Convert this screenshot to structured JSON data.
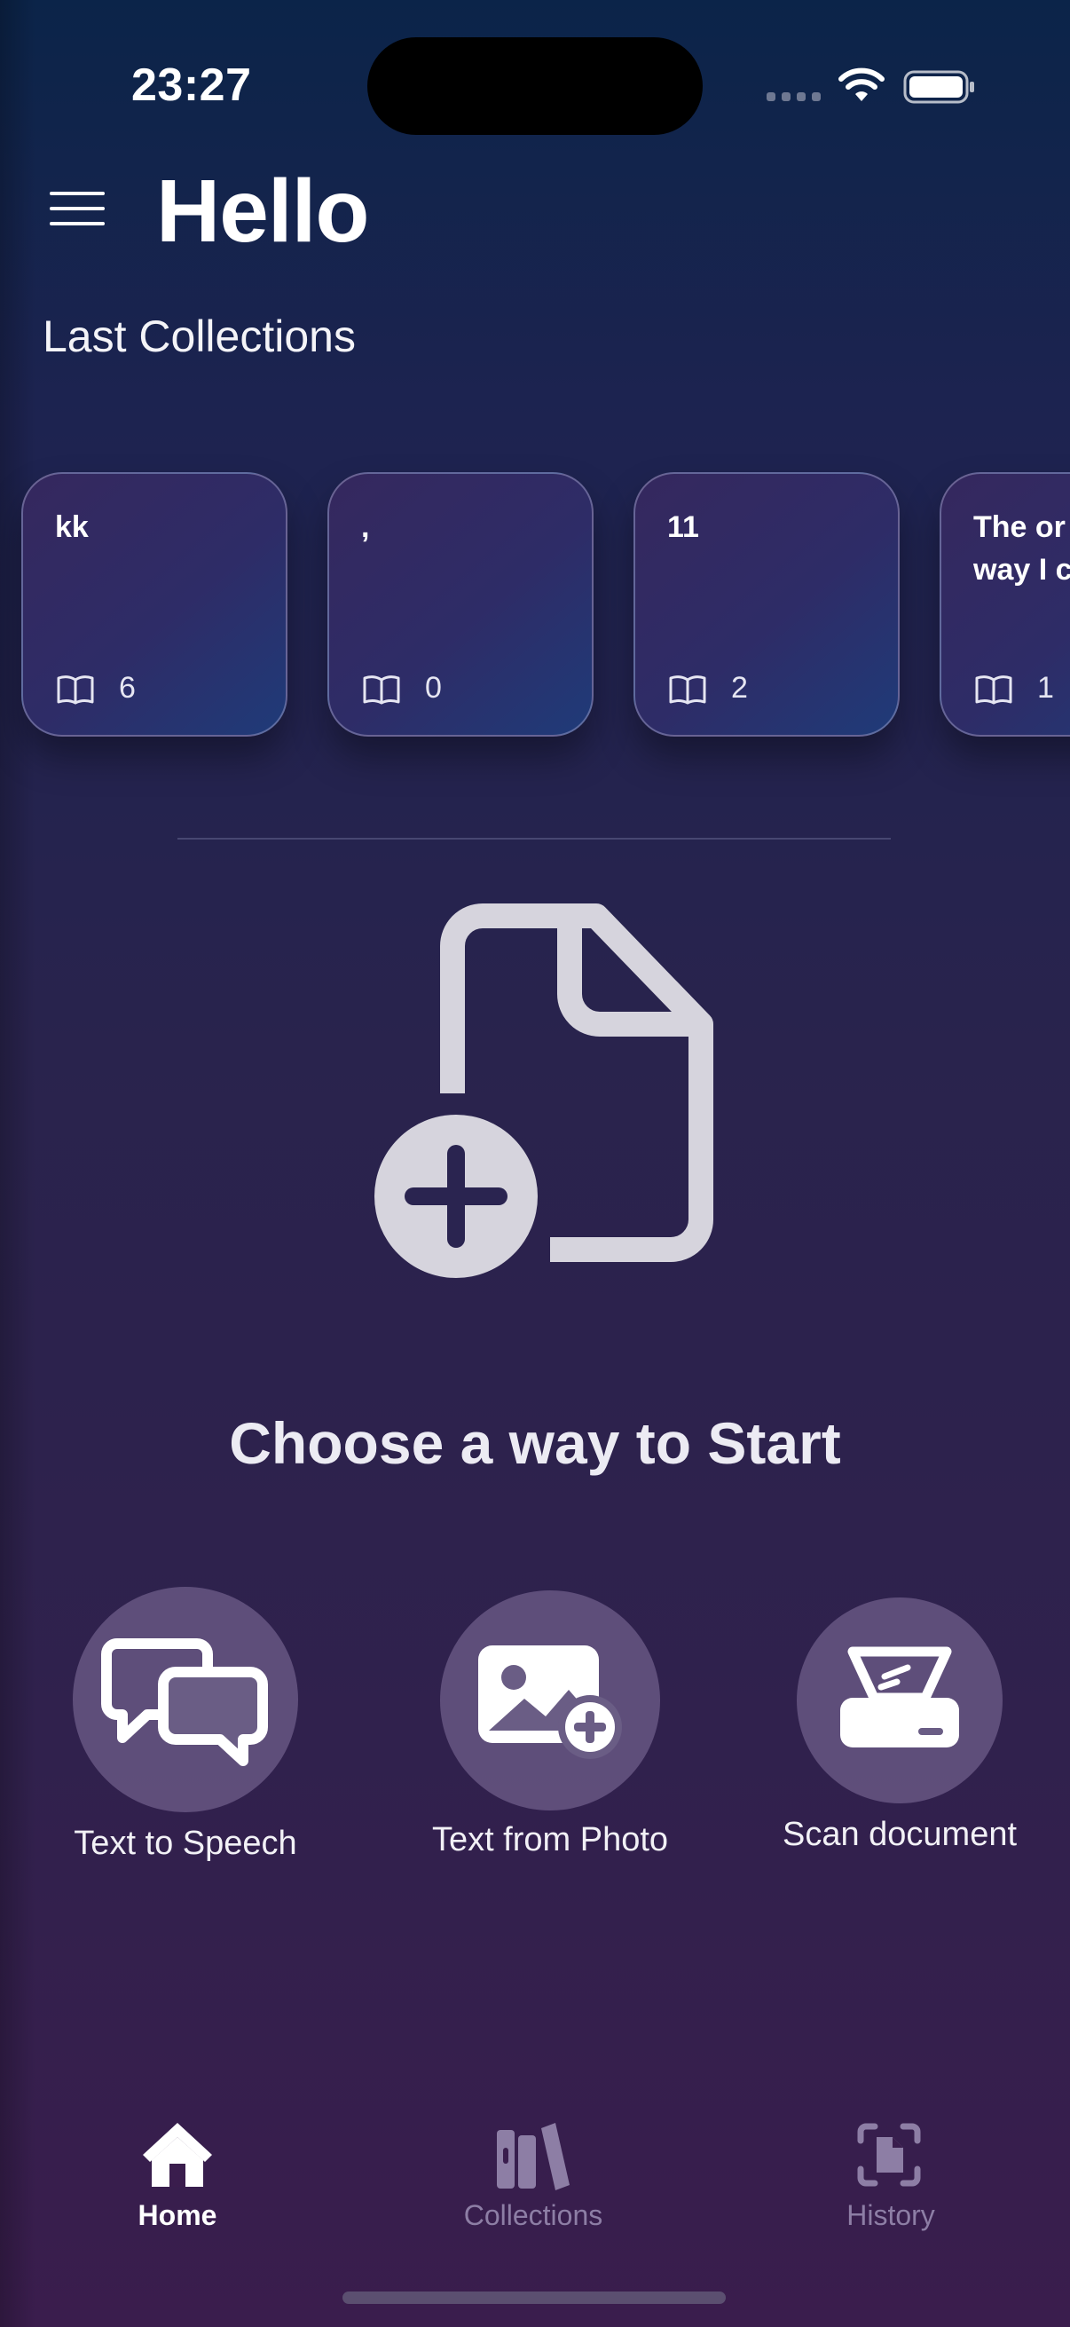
{
  "status_bar": {
    "time": "23:27"
  },
  "header": {
    "title": "Hello"
  },
  "collections": {
    "title": "Last Collections",
    "items": [
      {
        "title": "kk",
        "count": "6"
      },
      {
        "title": ",",
        "count": "0"
      },
      {
        "title": "11",
        "count": "2"
      },
      {
        "title": "The or\nway I c",
        "count": "1"
      }
    ]
  },
  "start": {
    "heading": "Choose a way to Start",
    "actions": [
      {
        "label": "Text to Speech",
        "icon": "speech-bubbles-icon"
      },
      {
        "label": "Text from Photo",
        "icon": "photo-add-icon"
      },
      {
        "label": "Scan document",
        "icon": "scanner-icon"
      }
    ]
  },
  "tab_bar": {
    "tabs": [
      {
        "label": "Home",
        "icon": "house-icon",
        "active": true
      },
      {
        "label": "Collections",
        "icon": "books-icon",
        "active": false
      },
      {
        "label": "History",
        "icon": "doc-scan-icon",
        "active": false
      }
    ]
  },
  "colors": {
    "background_top": "#0b2449",
    "background_bottom": "#3a1d4d",
    "tab_active": "#ffffff",
    "tab_inactive": "#8d7ea5",
    "icon_light": "#d6d4dd"
  }
}
